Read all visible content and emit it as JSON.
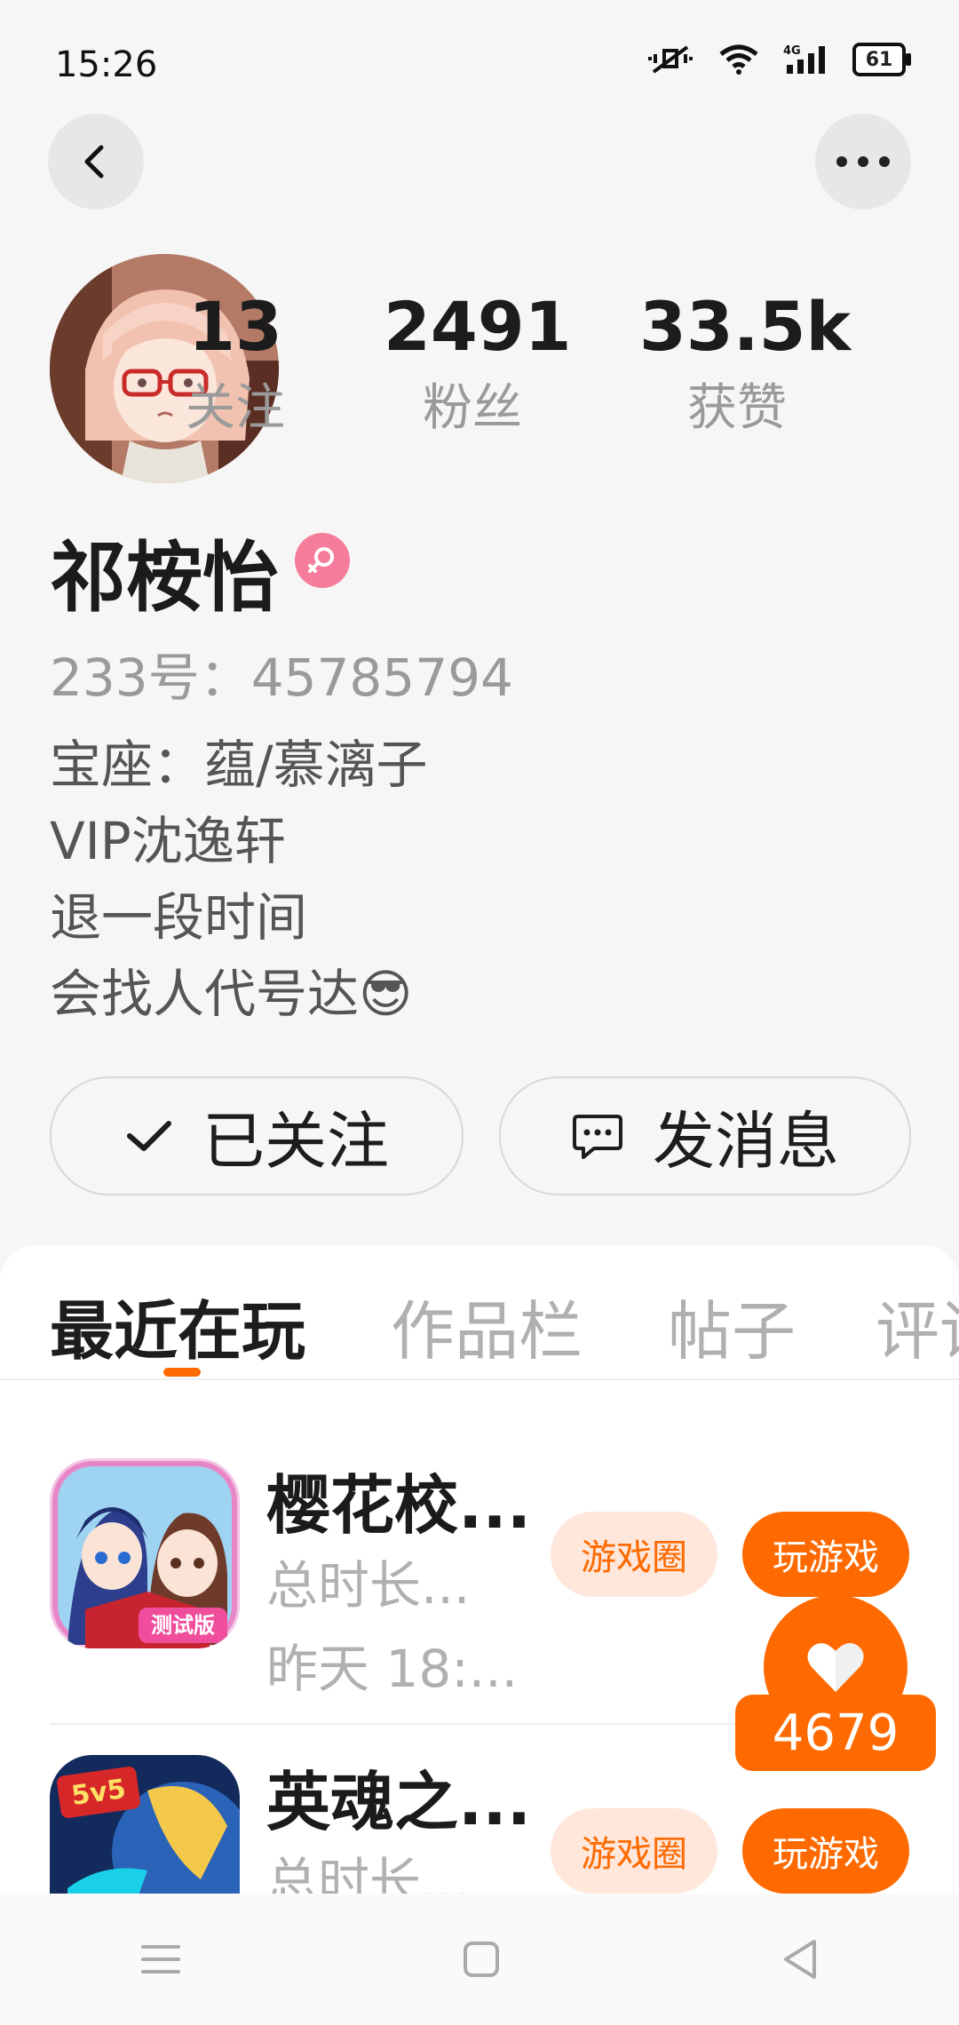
{
  "status_bar": {
    "time": "15:26",
    "battery": "61",
    "network": "4G"
  },
  "profile": {
    "stats": [
      {
        "value": "13",
        "label": "关注"
      },
      {
        "value": "2491",
        "label": "粉丝"
      },
      {
        "value": "33.5k",
        "label": "获赞"
      }
    ],
    "name": "祁桉怡",
    "gender": "female",
    "uid": "233号：45785794",
    "bio": [
      "宝座：蕴/慕漓子",
      "VIP沈逸轩",
      "退一段时间",
      "会找人代号达😎"
    ]
  },
  "actions": {
    "follow_label": "已关注",
    "message_label": "发消息"
  },
  "tabs": [
    "最近在玩",
    "作品栏",
    "帖子",
    "评论"
  ],
  "games": [
    {
      "name": "樱花校...",
      "total": "总时长...",
      "time": "昨天 18:...",
      "circle_label": "游戏圈",
      "play_label": "玩游戏",
      "badge": "测试版"
    },
    {
      "name": "英魂之...",
      "total": "总时长...",
      "time": "",
      "circle_label": "游戏圈",
      "play_label": "玩游戏",
      "badge": "5v5"
    }
  ],
  "like_float": {
    "count": "4679"
  },
  "colors": {
    "accent": "#ff6a00",
    "accent_light": "#ffe7dc",
    "gender_badge": "#f57c9a"
  },
  "icons": {
    "back": "chevron-left-icon",
    "more": "more-icon",
    "follow": "check-icon",
    "message": "chat-icon",
    "like": "heart-icon"
  }
}
